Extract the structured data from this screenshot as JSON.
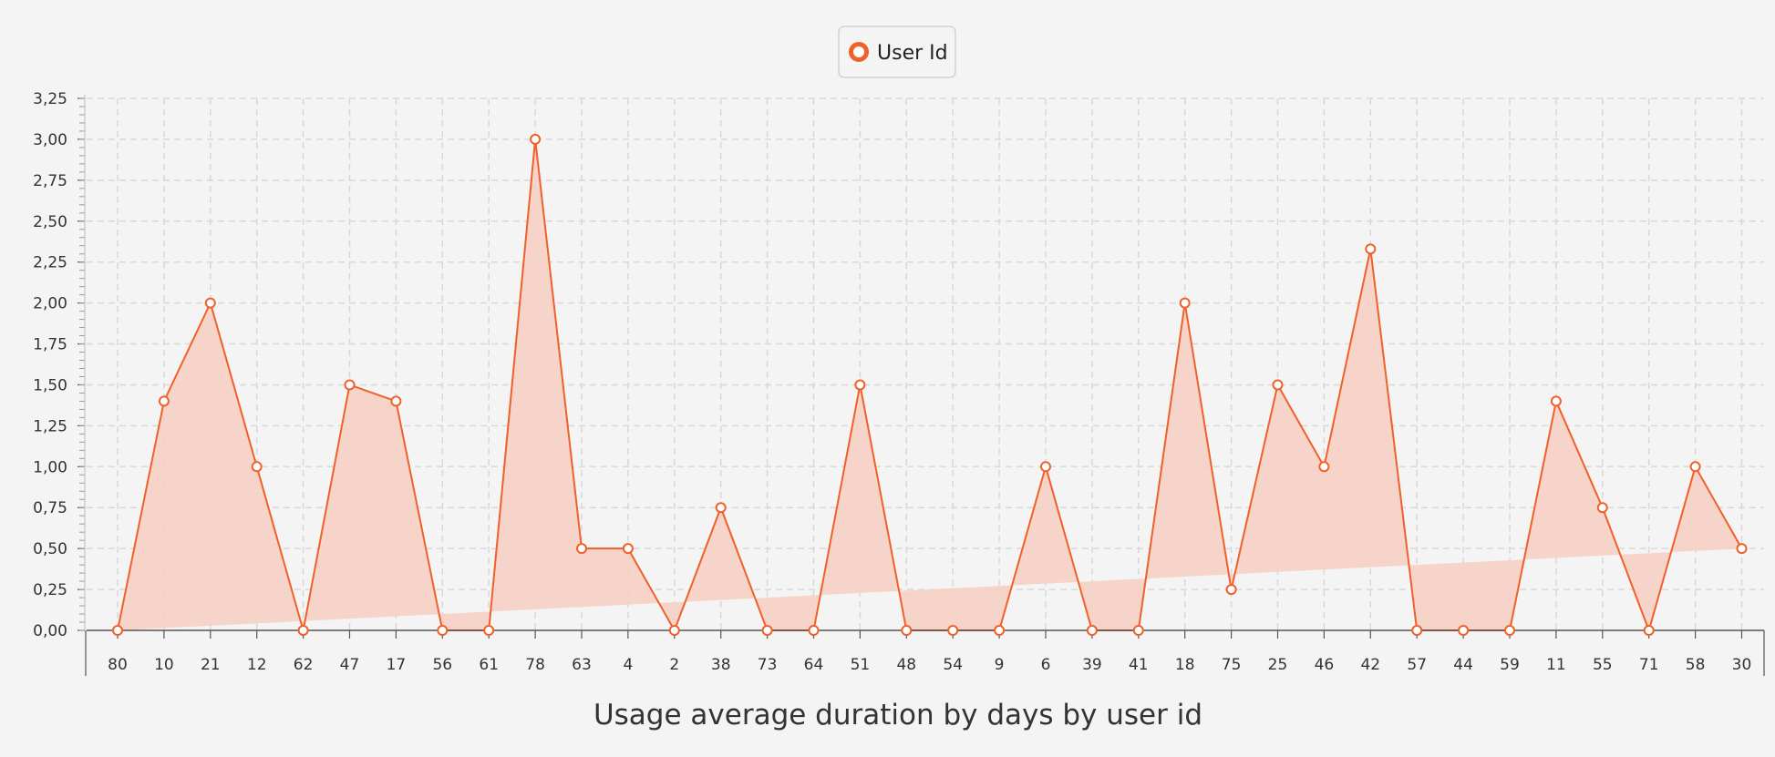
{
  "chart_data": {
    "type": "area",
    "categories": [
      "80",
      "10",
      "21",
      "12",
      "62",
      "47",
      "17",
      "56",
      "61",
      "78",
      "63",
      "4",
      "2",
      "38",
      "73",
      "64",
      "51",
      "48",
      "54",
      "9",
      "6",
      "39",
      "41",
      "18",
      "75",
      "25",
      "46",
      "42",
      "57",
      "44",
      "59",
      "11",
      "55",
      "71",
      "58",
      "30"
    ],
    "series": [
      {
        "name": "User Id",
        "values": [
          0,
          1.4,
          2,
          1,
          0,
          1.5,
          1.4,
          0,
          0,
          3,
          0.5,
          0.5,
          0,
          0.75,
          0,
          0,
          1.5,
          0,
          0,
          0,
          1,
          0,
          0,
          2,
          0.25,
          1.5,
          1,
          2.33,
          0,
          0,
          0,
          1.4,
          0.75,
          0,
          1,
          0.5
        ]
      }
    ],
    "ylim": [
      0,
      3.25
    ],
    "yticks": [
      "0,00",
      "0,25",
      "0,50",
      "0,75",
      "1,00",
      "1,25",
      "1,50",
      "1,75",
      "2,00",
      "2,25",
      "2,50",
      "2,75",
      "3,00",
      "3,25"
    ],
    "xlabel": "Usage average duration by days by user id",
    "ylabel": "",
    "legend": {
      "position": "top-center"
    },
    "grid": true,
    "colors": {
      "line": "#f0602a",
      "fill": "#f5d2c6",
      "grid": "#d8d8d8",
      "axis": "#555555",
      "marker_fill": "#ffffff"
    }
  }
}
